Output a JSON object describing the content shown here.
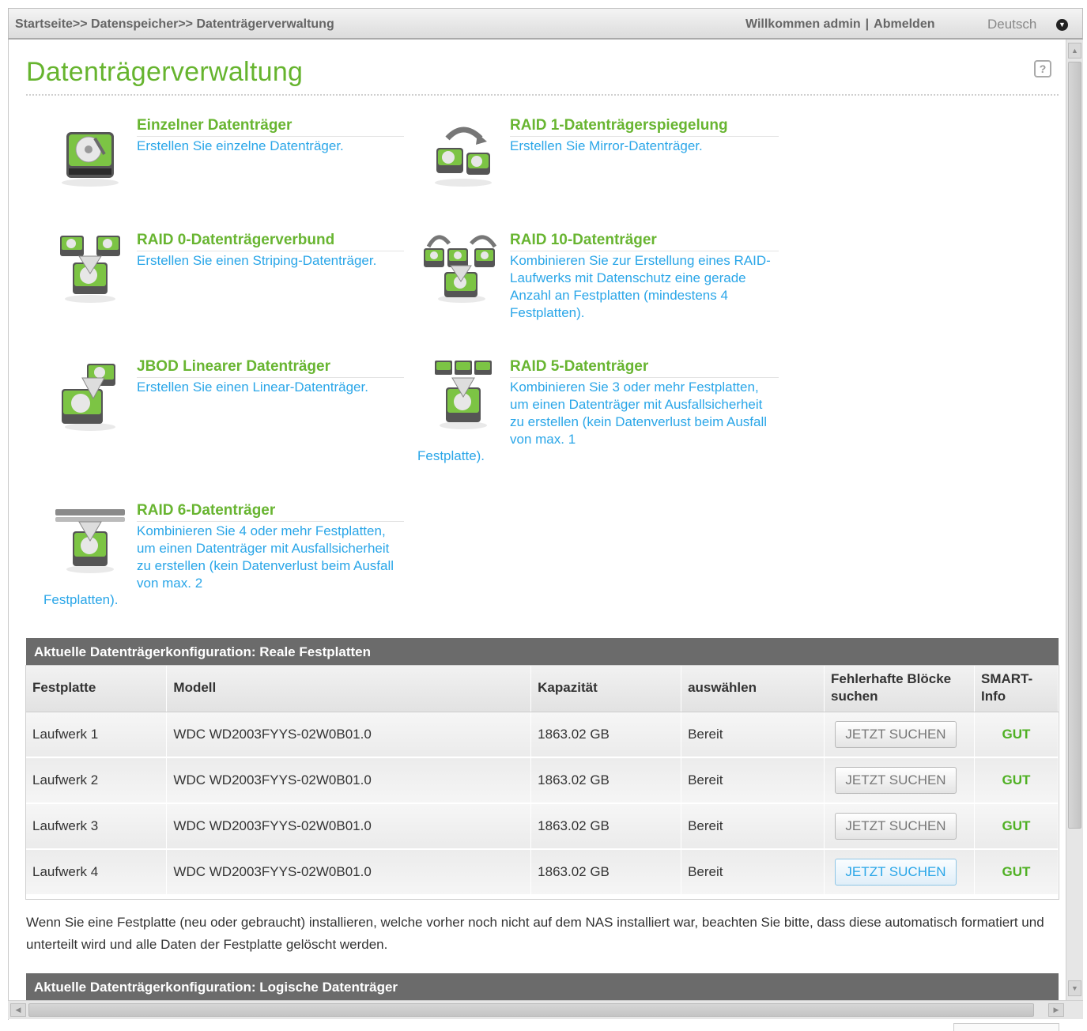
{
  "header": {
    "breadcrumb": "Startseite>> Datenspeicher>> Datenträgerverwaltung",
    "welcome": "Willkommen admin",
    "separator": "|",
    "logout": "Abmelden",
    "language": "Deutsch"
  },
  "page": {
    "title": "Datenträgerverwaltung",
    "help_icon": "?"
  },
  "options": [
    {
      "title": "Einzelner Datenträger",
      "desc": "Erstellen Sie einzelne Datenträger.",
      "tail": "",
      "icon": "single-disk-icon"
    },
    {
      "title": "RAID 1-Datenträgerspiegelung",
      "desc": "Erstellen Sie Mirror-Datenträger.",
      "tail": "",
      "icon": "raid1-mirror-icon"
    },
    {
      "title": "RAID 0-Datenträgerverbund",
      "desc": "Erstellen Sie einen Striping-Datenträger.",
      "tail": "",
      "icon": "raid0-stripe-icon"
    },
    {
      "title": "RAID 10-Datenträger",
      "desc": "Kombinieren Sie zur Erstellung eines RAID-Laufwerks mit Datenschutz eine gerade Anzahl an Festplatten (mindestens 4 Festplatten).",
      "tail": "",
      "icon": "raid10-icon"
    },
    {
      "title": "JBOD Linearer Datenträger",
      "desc": "Erstellen Sie einen Linear-Datenträger.",
      "tail": "",
      "icon": "jbod-linear-icon"
    },
    {
      "title": "RAID 5-Datenträger",
      "desc": "Kombinieren Sie 3 oder mehr Festplatten, um einen Datenträger mit Ausfallsicherheit zu erstellen (kein Datenverlust beim Ausfall von max. 1",
      "tail": "Festplatte).",
      "icon": "raid5-icon"
    },
    {
      "title": "RAID 6-Datenträger",
      "desc": "Kombinieren Sie 4 oder mehr Festplatten, um einen Datenträger mit Ausfallsicherheit zu erstellen (kein Datenverlust beim Ausfall von max. 2",
      "tail": "Festplatten).",
      "icon": "raid6-icon"
    }
  ],
  "physical_disks": {
    "header": "Aktuelle Datenträgerkonfiguration: Reale Festplatten",
    "columns": [
      "Festplatte",
      "Modell",
      "Kapazität",
      "auswählen",
      "Fehlerhafte Blöcke suchen",
      "SMART-Info"
    ],
    "rows": [
      {
        "disk": "Laufwerk 1",
        "model": "WDC WD2003FYYS-02W0B01.0",
        "capacity": "1863.02 GB",
        "status": "Bereit",
        "action": "JETZT SUCHEN",
        "smart": "GUT"
      },
      {
        "disk": "Laufwerk 2",
        "model": "WDC WD2003FYYS-02W0B01.0",
        "capacity": "1863.02 GB",
        "status": "Bereit",
        "action": "JETZT SUCHEN",
        "smart": "GUT"
      },
      {
        "disk": "Laufwerk 3",
        "model": "WDC WD2003FYYS-02W0B01.0",
        "capacity": "1863.02 GB",
        "status": "Bereit",
        "action": "JETZT SUCHEN",
        "smart": "GUT"
      },
      {
        "disk": "Laufwerk 4",
        "model": "WDC WD2003FYYS-02W0B01.0",
        "capacity": "1863.02 GB",
        "status": "Bereit",
        "action": "JETZT SUCHEN",
        "smart": "GUT"
      }
    ]
  },
  "notice": "Wenn Sie eine Festplatte (neu oder gebraucht) installieren, welche vorher noch nicht auf dem NAS installiert war, beachten Sie bitte, dass diese automatisch formatiert und unterteilt wird und alle Daten der Festplatte gelöscht werden.",
  "logical_volumes": {
    "header": "Aktuelle Datenträgerkonfiguration: Logische Datenträger"
  },
  "colors": {
    "accent_green": "#68b531",
    "link_blue": "#2aa6e8",
    "table_header": "#6b6b6b"
  }
}
